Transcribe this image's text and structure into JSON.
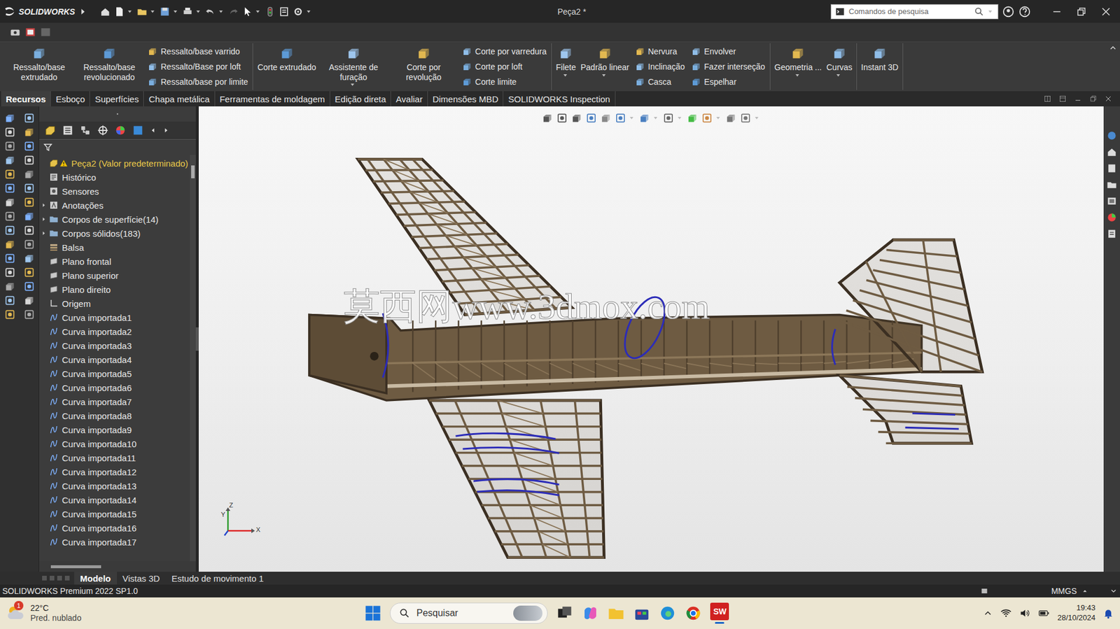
{
  "window": {
    "app": "SOLIDWORKS",
    "title": "Peça2 *",
    "search": {
      "placeholder": "Comandos de pesquisa"
    }
  },
  "ribbon": [
    {
      "columns": [
        {
          "kind": "big",
          "label": "Ressalto/base extrudado",
          "dropdown": false
        },
        {
          "kind": "big",
          "label": "Ressalto/base revolucionado",
          "dropdown": false
        },
        {
          "kind": "stack",
          "items": [
            "Ressalto/base varrido",
            "Ressalto/Base por loft",
            "Ressalto/base por limite"
          ]
        }
      ]
    },
    {
      "columns": [
        {
          "kind": "big",
          "label": "Corte extrudado",
          "dropdown": false
        },
        {
          "kind": "big",
          "label": "Assistente de furação",
          "dropdown": true
        },
        {
          "kind": "big",
          "label": "Corte por revolução",
          "dropdown": false
        },
        {
          "kind": "stack",
          "items": [
            "Corte por varredura",
            "Corte por loft",
            "Corte limite"
          ]
        }
      ]
    },
    {
      "columns": [
        {
          "kind": "big",
          "label": "Filete",
          "dropdown": true
        },
        {
          "kind": "big",
          "label": "Padrão linear",
          "dropdown": true
        },
        {
          "kind": "stack",
          "items": [
            "Nervura",
            "Inclinação",
            "Casca"
          ]
        },
        {
          "kind": "stack",
          "items": [
            "Envolver",
            "Fazer interseção",
            "Espelhar"
          ]
        }
      ]
    },
    {
      "columns": [
        {
          "kind": "big",
          "label": "Geometria ...",
          "dropdown": true
        },
        {
          "kind": "big",
          "label": "Curvas",
          "dropdown": true
        }
      ]
    },
    {
      "columns": [
        {
          "kind": "big",
          "label": "Instant 3D",
          "dropdown": false
        }
      ]
    }
  ],
  "tabs": [
    {
      "label": "Recursos",
      "selected": true
    },
    {
      "label": "Esboço",
      "selected": false
    },
    {
      "label": "Superfícies",
      "selected": false
    },
    {
      "label": "Chapa metálica",
      "selected": false
    },
    {
      "label": "Ferramentas de moldagem",
      "selected": false
    },
    {
      "label": "Edição direta",
      "selected": false
    },
    {
      "label": "Avaliar",
      "selected": false
    },
    {
      "label": "Dimensões MBD",
      "selected": false
    },
    {
      "label": "SOLIDWORKS Inspection",
      "selected": false
    }
  ],
  "feature_tree": {
    "items": [
      {
        "label": "Peça2 (Valor predeterminado)",
        "kind": "root",
        "expandable": false,
        "expanded": false,
        "warning": true
      },
      {
        "label": "Histórico",
        "kind": "history",
        "expandable": false,
        "expanded": false,
        "warning": false
      },
      {
        "label": "Sensores",
        "kind": "sensors",
        "expandable": false,
        "expanded": false,
        "warning": false
      },
      {
        "label": "Anotações",
        "kind": "annotations",
        "expandable": true,
        "expanded": false,
        "warning": false
      },
      {
        "label": "Corpos de superfície(14)",
        "kind": "bodies",
        "expandable": true,
        "expanded": false,
        "warning": false
      },
      {
        "label": "Corpos sólidos(183)",
        "kind": "bodies",
        "expandable": true,
        "expanded": false,
        "warning": false
      },
      {
        "label": "Balsa",
        "kind": "material",
        "expandable": false,
        "expanded": false,
        "warning": false
      },
      {
        "label": "Plano frontal",
        "kind": "plane",
        "expandable": false,
        "expanded": false,
        "warning": false
      },
      {
        "label": "Plano superior",
        "kind": "plane",
        "expandable": false,
        "expanded": false,
        "warning": false
      },
      {
        "label": "Plano direito",
        "kind": "plane",
        "expandable": false,
        "expanded": false,
        "warning": false
      },
      {
        "label": "Origem",
        "kind": "origin",
        "expandable": false,
        "expanded": false,
        "warning": false
      },
      {
        "label": "Curva importada1",
        "kind": "curve",
        "expandable": false,
        "expanded": false,
        "warning": false
      },
      {
        "label": "Curva importada2",
        "kind": "curve",
        "expandable": false,
        "expanded": false,
        "warning": false
      },
      {
        "label": "Curva importada3",
        "kind": "curve",
        "expandable": false,
        "expanded": false,
        "warning": false
      },
      {
        "label": "Curva importada4",
        "kind": "curve",
        "expandable": false,
        "expanded": false,
        "warning": false
      },
      {
        "label": "Curva importada5",
        "kind": "curve",
        "expandable": false,
        "expanded": false,
        "warning": false
      },
      {
        "label": "Curva importada6",
        "kind": "curve",
        "expandable": false,
        "expanded": false,
        "warning": false
      },
      {
        "label": "Curva importada7",
        "kind": "curve",
        "expandable": false,
        "expanded": false,
        "warning": false
      },
      {
        "label": "Curva importada8",
        "kind": "curve",
        "expandable": false,
        "expanded": false,
        "warning": false
      },
      {
        "label": "Curva importada9",
        "kind": "curve",
        "expandable": false,
        "expanded": false,
        "warning": false
      },
      {
        "label": "Curva importada10",
        "kind": "curve",
        "expandable": false,
        "expanded": false,
        "warning": false
      },
      {
        "label": "Curva importada11",
        "kind": "curve",
        "expandable": false,
        "expanded": false,
        "warning": false
      },
      {
        "label": "Curva importada12",
        "kind": "curve",
        "expandable": false,
        "expanded": false,
        "warning": false
      },
      {
        "label": "Curva importada13",
        "kind": "curve",
        "expandable": false,
        "expanded": false,
        "warning": false
      },
      {
        "label": "Curva importada14",
        "kind": "curve",
        "expandable": false,
        "expanded": false,
        "warning": false
      },
      {
        "label": "Curva importada15",
        "kind": "curve",
        "expandable": false,
        "expanded": false,
        "warning": false
      },
      {
        "label": "Curva importada16",
        "kind": "curve",
        "expandable": false,
        "expanded": false,
        "warning": false
      },
      {
        "label": "Curva importada17",
        "kind": "curve",
        "expandable": false,
        "expanded": false,
        "warning": false
      }
    ]
  },
  "viewport": {
    "watermark": "莫西网www.3dmox.com",
    "triad": {
      "x": "X",
      "y": "Y",
      "z": "Z"
    }
  },
  "bottom_tabs": [
    {
      "label": "Modelo",
      "selected": true
    },
    {
      "label": "Vistas 3D",
      "selected": false
    },
    {
      "label": "Estudo de movimento 1",
      "selected": false
    }
  ],
  "status_bar": {
    "product": "SOLIDWORKS Premium 2022 SP1.0",
    "units": "MMGS"
  },
  "taskbar": {
    "weather": {
      "temp": "22°C",
      "desc": "Pred. nublado",
      "badge": "1"
    },
    "search": "Pesquisar",
    "sw_icon_text": "SW",
    "time": "19:43",
    "date": "28/10/2024"
  }
}
